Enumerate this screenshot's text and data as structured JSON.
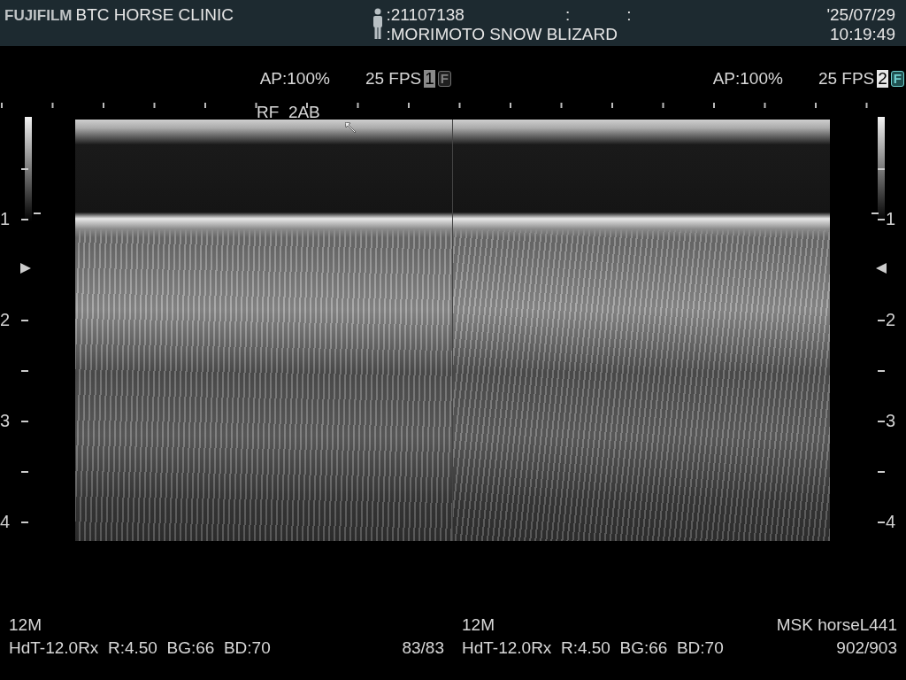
{
  "header": {
    "brand": "FUJIFILM",
    "clinic": "BTC HORSE CLINIC",
    "patient_id": ":21107138",
    "separators": [
      ":",
      ":"
    ],
    "patient_name": ":MORIMOTO SNOW BLIZARD",
    "date": "'25/07/29",
    "time": "10:19:49"
  },
  "panels": [
    {
      "ap": "AP:100%",
      "fps": "25 FPS",
      "number": "1",
      "freeze": "F",
      "selected": false,
      "annotation": "RF  2AB",
      "frequency": "12M",
      "params": "HdT-12.0Rx  R:4.50  BG:66  BD:70",
      "frames": "83/83"
    },
    {
      "ap": "AP:100%",
      "fps": "25 FPS",
      "number": "2",
      "freeze": "F",
      "selected": true,
      "preset": "MSK horseL441",
      "frequency": "12M",
      "params": "HdT-12.0Rx  R:4.50  BG:66  BD:70",
      "frames": "902/903"
    }
  ],
  "depth_scale": {
    "left_labels": [
      "1",
      "2",
      "3",
      "4"
    ],
    "right_labels": [
      "1",
      "2",
      "3",
      "4"
    ]
  }
}
